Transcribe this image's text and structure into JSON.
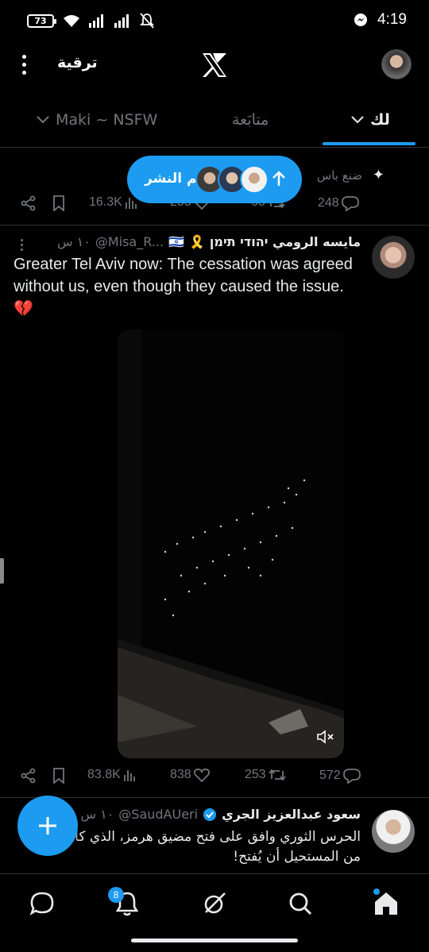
{
  "status_bar": {
    "battery": "73",
    "time": "4:19",
    "icons": [
      "wifi-icon",
      "signal-icon",
      "signal-icon",
      "mute-icon",
      "messenger-icon"
    ]
  },
  "header": {
    "upgrade_label": "ترقية",
    "logo": "x-logo-icon"
  },
  "tabs": [
    {
      "label": "Maki ~ NSFW",
      "has_chevron": true,
      "active": false
    },
    {
      "label": "متابَعة",
      "active": false
    },
    {
      "label": "لك",
      "has_chevron": true,
      "active": true
    }
  ],
  "tweet1": {
    "context_text": "ضنع باس",
    "stats": {
      "replies": "248",
      "reposts": "65",
      "likes": "255",
      "views": "16.3K"
    }
  },
  "posted_pill": {
    "label": "تم النشر"
  },
  "tweet2": {
    "name": "مايسه الرومي יהודי תימן",
    "name_emoji": "🎗️",
    "flag_emoji": "🇮🇱",
    "handle": "@Misa_R...",
    "time": "١٠ س",
    "text": "Greater Tel Aviv now: The cessation was agreed without us, even though they caused the issue.💔",
    "stats": {
      "replies": "572",
      "reposts": "253",
      "likes": "838",
      "views": "83.8K"
    }
  },
  "tweet3": {
    "name": "سعود عبدالعزيز الجري",
    "handle": "@SaudAUeri",
    "time": "١٠ س",
    "text": "الحرس الثوري وافق على فتح مضيق هرمز، الذي كان إنه من المستحيل أن يُفتح!"
  },
  "bottom_nav": {
    "items": [
      "chat-icon",
      "bell-icon",
      "grok-icon",
      "search-icon",
      "home-icon"
    ],
    "notifications_badge": "8"
  },
  "colors": {
    "accent": "#1d9bf0",
    "text": "#e7e9ea",
    "muted": "#71767b",
    "border": "#2f3336",
    "background": "#000000"
  }
}
